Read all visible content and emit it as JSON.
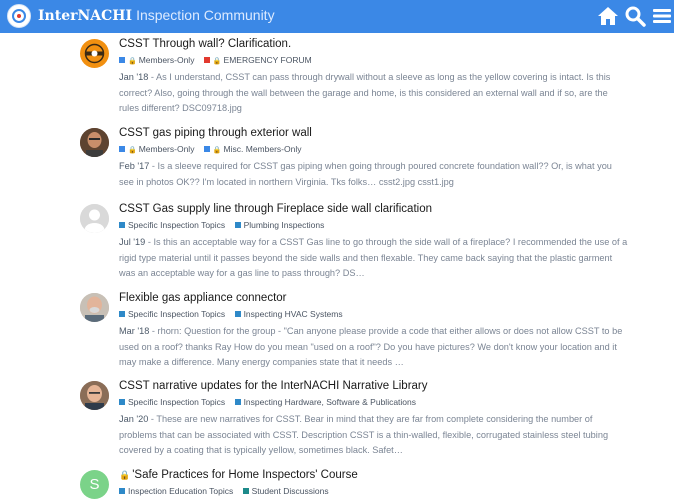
{
  "header": {
    "brand_name": "InterNACHI",
    "brand_sub": "Inspection Community",
    "icons": [
      "home-icon",
      "search-icon",
      "hamburger-menu-icon"
    ],
    "color": "#3b88e6"
  },
  "topics": [
    {
      "title": "CSST Through wall? Clarification.",
      "avatar_icon": "orange-logo-avatar",
      "categories": [
        {
          "label": "Members-Only",
          "color": "#3b88e6",
          "locked": true
        },
        {
          "label": "EMERGENCY FORUM",
          "color": "#e23a2f",
          "locked": true
        }
      ],
      "date": "Jan '18",
      "excerpt": "As I understand, CSST can pass through drywall without a sleeve as long as the yellow covering is intact. Is this correct? Also, going through the wall between the garage and home, is this considered an external wall and if so, are the rules different? DSC09718.jpg"
    },
    {
      "title": "CSST gas piping through exterior wall",
      "avatar_icon": "user-photo-avatar",
      "categories": [
        {
          "label": "Members-Only",
          "color": "#3b88e6",
          "locked": true
        },
        {
          "label": "Misc. Members-Only",
          "color": "#3b88e6",
          "locked": true
        }
      ],
      "date": "Feb '17",
      "excerpt": "Is a sleeve required for CSST gas piping when going through poured concrete foundation wall?? Or, is what you see in photos OK?? I'm located in northern Virginia. Tks folks… csst2.jpg csst1.jpg"
    },
    {
      "title": "CSST Gas supply line through Fireplace side wall clarification",
      "avatar_icon": "default-avatar",
      "categories": [
        {
          "label": "Specific Inspection Topics",
          "color": "#2e89c8",
          "locked": false
        },
        {
          "label": "Plumbing Inspections",
          "color": "#2e89c8",
          "locked": false
        }
      ],
      "date": "Jul '19",
      "excerpt": "Is this an acceptable way for a CSST Gas line to go through the side wall of a fireplace? I recommended the use of a rigid type material until it passes beyond the side walls and then flexable. They came back saying that the plastic garment was an acceptable way for a gas line to pass through? DS…"
    },
    {
      "title": "Flexible gas appliance connector",
      "avatar_icon": "user-photo-avatar",
      "categories": [
        {
          "label": "Specific Inspection Topics",
          "color": "#2e89c8",
          "locked": false
        },
        {
          "label": "Inspecting HVAC Systems",
          "color": "#2e89c8",
          "locked": false
        }
      ],
      "date": "Mar '18",
      "excerpt": "rhorn: Question for the group - \"Can anyone please provide a code that either allows or does not allow CSST to be used on a roof? thanks Ray How do you mean \"used on a roof\"? Do you have pictures? We don't know your location and it may make a difference. Many energy companies state that it needs …"
    },
    {
      "title": "CSST narrative updates for the InterNACHI Narrative Library",
      "avatar_icon": "user-photo-avatar",
      "categories": [
        {
          "label": "Specific Inspection Topics",
          "color": "#2e89c8",
          "locked": false
        },
        {
          "label": "Inspecting Hardware, Software & Publications",
          "color": "#2e89c8",
          "locked": false
        }
      ],
      "date": "Jan '20",
      "excerpt": "These are new narratives for CSST. Bear in mind that they are far from complete considering the number of problems that can be associated with CSST. Description CSST is a thin-walled, flexible, corrugated stainless steel tubing covered by a coating that is typically yellow, sometimes black. Safet…"
    },
    {
      "title": "'Safe Practices for Home Inspectors' Course",
      "avatar_icon": "letter-avatar",
      "avatar_letter": "S",
      "title_locked": true,
      "categories": [
        {
          "label": "Inspection Education Topics",
          "color": "#2e89c8",
          "locked": false
        },
        {
          "label": "Student Discussions",
          "color": "#1d8a8a",
          "locked": false
        }
      ],
      "date": "",
      "excerpt": ""
    }
  ]
}
